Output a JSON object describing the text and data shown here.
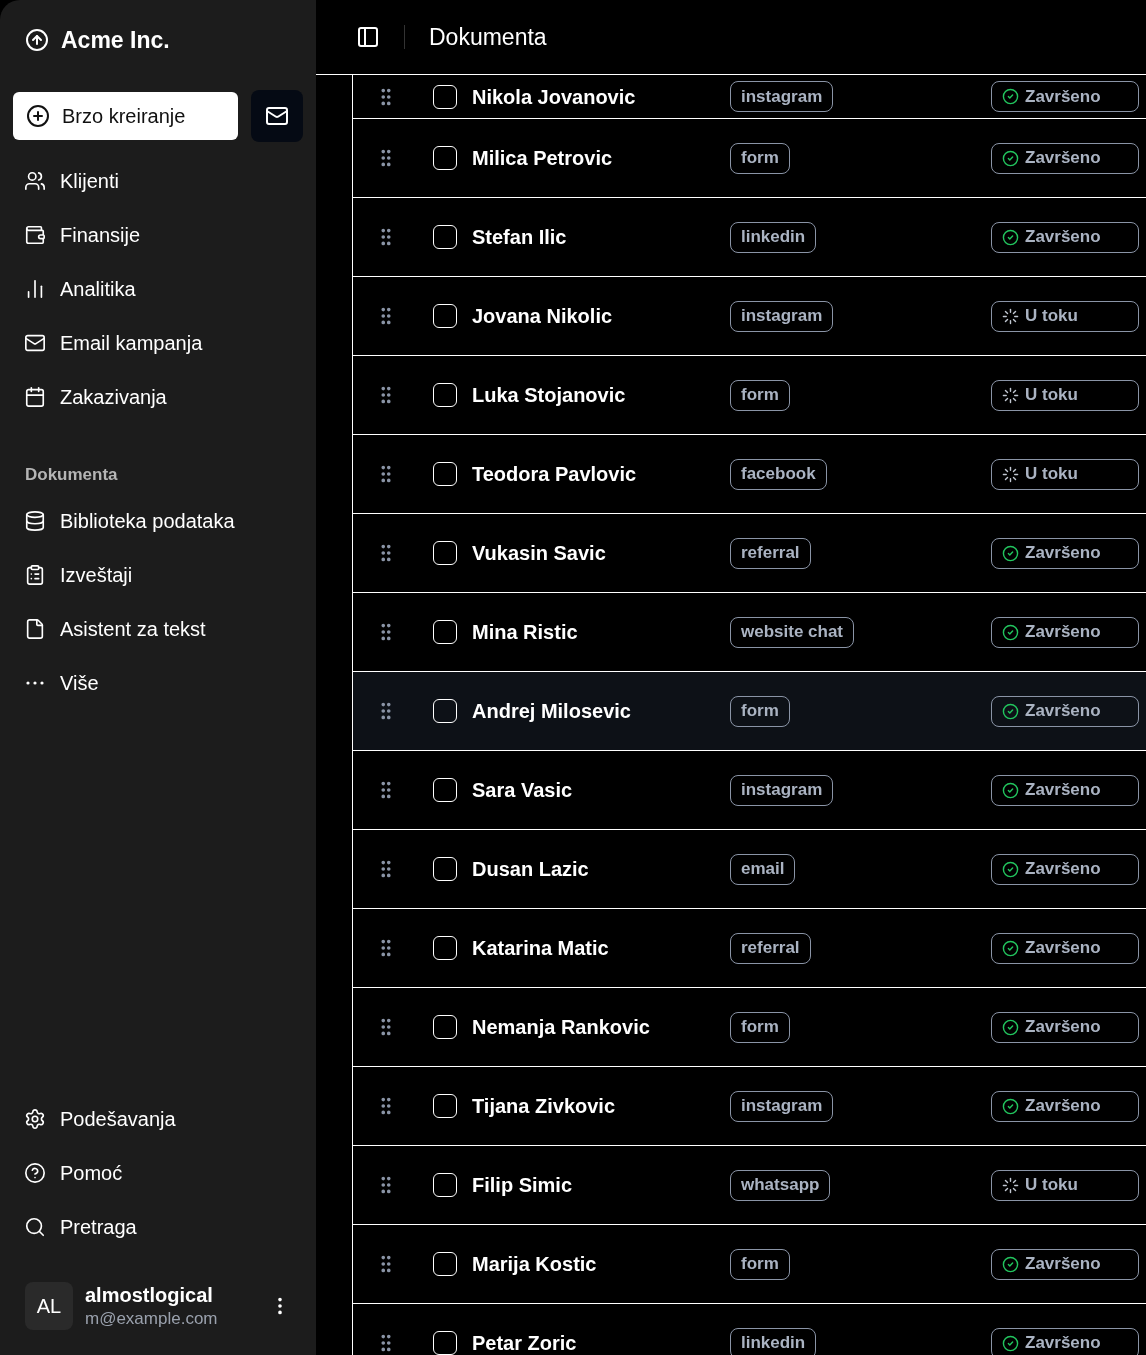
{
  "sidebar": {
    "brand": "Acme Inc.",
    "quick_create": "Brzo kreiranje",
    "nav": [
      {
        "label": "Klijenti"
      },
      {
        "label": "Finansije"
      },
      {
        "label": "Analitika"
      },
      {
        "label": "Email kampanja"
      },
      {
        "label": "Zakazivanja"
      }
    ],
    "documents_heading": "Dokumenta",
    "documents": [
      {
        "label": "Biblioteka podataka"
      },
      {
        "label": "Izveštaji"
      },
      {
        "label": "Asistent za tekst"
      },
      {
        "label": "Više"
      }
    ],
    "footer_nav": [
      {
        "label": "Podešavanja"
      },
      {
        "label": "Pomoć"
      },
      {
        "label": "Pretraga"
      }
    ],
    "user": {
      "initials": "AL",
      "name": "almostlogical",
      "email": "m@example.com"
    }
  },
  "header": {
    "title": "Dokumenta"
  },
  "rows": [
    {
      "name": "Nikola Jovanovic",
      "source": "instagram",
      "status": "Završeno",
      "kind": "done",
      "checked": false,
      "highlighted": false
    },
    {
      "name": "Milica Petrovic",
      "source": "form",
      "status": "Završeno",
      "kind": "done",
      "checked": false,
      "highlighted": false
    },
    {
      "name": "Stefan Ilic",
      "source": "linkedin",
      "status": "Završeno",
      "kind": "done",
      "checked": false,
      "highlighted": false
    },
    {
      "name": "Jovana Nikolic",
      "source": "instagram",
      "status": "U toku",
      "kind": "progress",
      "checked": false,
      "highlighted": false
    },
    {
      "name": "Luka Stojanovic",
      "source": "form",
      "status": "U toku",
      "kind": "progress",
      "checked": false,
      "highlighted": false
    },
    {
      "name": "Teodora Pavlovic",
      "source": "facebook",
      "status": "U toku",
      "kind": "progress",
      "checked": false,
      "highlighted": false
    },
    {
      "name": "Vukasin Savic",
      "source": "referral",
      "status": "Završeno",
      "kind": "done",
      "checked": false,
      "highlighted": false
    },
    {
      "name": "Mina Ristic",
      "source": "website chat",
      "status": "Završeno",
      "kind": "done",
      "checked": false,
      "highlighted": false
    },
    {
      "name": "Andrej Milosevic",
      "source": "form",
      "status": "Završeno",
      "kind": "done",
      "checked": false,
      "highlighted": true
    },
    {
      "name": "Sara Vasic",
      "source": "instagram",
      "status": "Završeno",
      "kind": "done",
      "checked": false,
      "highlighted": false
    },
    {
      "name": "Dusan Lazic",
      "source": "email",
      "status": "Završeno",
      "kind": "done",
      "checked": false,
      "highlighted": false
    },
    {
      "name": "Katarina Matic",
      "source": "referral",
      "status": "Završeno",
      "kind": "done",
      "checked": false,
      "highlighted": false
    },
    {
      "name": "Nemanja Rankovic",
      "source": "form",
      "status": "Završeno",
      "kind": "done",
      "checked": false,
      "highlighted": false
    },
    {
      "name": "Tijana Zivkovic",
      "source": "instagram",
      "status": "Završeno",
      "kind": "done",
      "checked": false,
      "highlighted": false
    },
    {
      "name": "Filip Simic",
      "source": "whatsapp",
      "status": "U toku",
      "kind": "progress",
      "checked": false,
      "highlighted": false
    },
    {
      "name": "Marija Kostic",
      "source": "form",
      "status": "Završeno",
      "kind": "done",
      "checked": false,
      "highlighted": false
    },
    {
      "name": "Petar Zoric",
      "source": "linkedin",
      "status": "Završeno",
      "kind": "done",
      "checked": false,
      "highlighted": false
    }
  ]
}
